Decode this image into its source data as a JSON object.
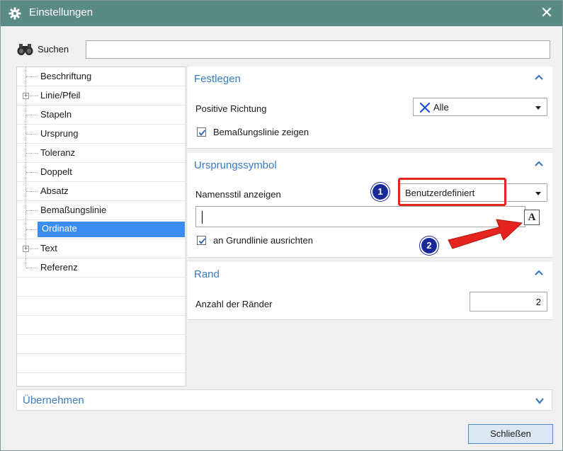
{
  "window": {
    "title": "Einstellungen",
    "close_glyph": "✕",
    "icon": "gear-icon"
  },
  "search": {
    "label": "Suchen",
    "value": "",
    "icon": "binoculars-icon"
  },
  "tree": {
    "items": [
      {
        "label": "Beschriftung",
        "expandable": false,
        "selected": false
      },
      {
        "label": "Linie/Pfeil",
        "expandable": true,
        "selected": false
      },
      {
        "label": "Stapeln",
        "expandable": false,
        "selected": false
      },
      {
        "label": "Ursprung",
        "expandable": false,
        "selected": false
      },
      {
        "label": "Toleranz",
        "expandable": false,
        "selected": false
      },
      {
        "label": "Doppelt",
        "expandable": false,
        "selected": false
      },
      {
        "label": "Absatz",
        "expandable": false,
        "selected": false
      },
      {
        "label": "Bemaßungslinie",
        "expandable": false,
        "selected": false
      },
      {
        "label": "Ordinate",
        "expandable": false,
        "selected": true
      },
      {
        "label": "Text",
        "expandable": true,
        "selected": false
      },
      {
        "label": "Referenz",
        "expandable": false,
        "selected": false
      }
    ],
    "expander_glyph": "+"
  },
  "festlegen": {
    "title": "Festlegen",
    "positive_richtung_label": "Positive Richtung",
    "positive_richtung_value": "Alle",
    "show_dim_line_label": "Bemaßungslinie zeigen",
    "show_dim_line_checked": true
  },
  "ursprungssymbol": {
    "title": "Ursprungssymbol",
    "name_style_label": "Namensstil anzeigen",
    "name_style_value": "Benutzerdefiniert",
    "text_value": "",
    "align_label": "an Grundlinie ausrichten",
    "align_checked": true,
    "font_button_glyph": "A"
  },
  "rand": {
    "title": "Rand",
    "count_label": "Anzahl der Ränder",
    "count_value": "2"
  },
  "apply": {
    "title": "Übernehmen"
  },
  "footer": {
    "close_label": "Schließen"
  },
  "annotations": {
    "badge1": "1",
    "badge2": "2"
  },
  "colors": {
    "titlebar": "#5a8a84",
    "section_title": "#3a7bbf",
    "selection": "#3b8ef0",
    "annotation_red": "#e52420",
    "annotation_blue": "#1b2a9a"
  }
}
